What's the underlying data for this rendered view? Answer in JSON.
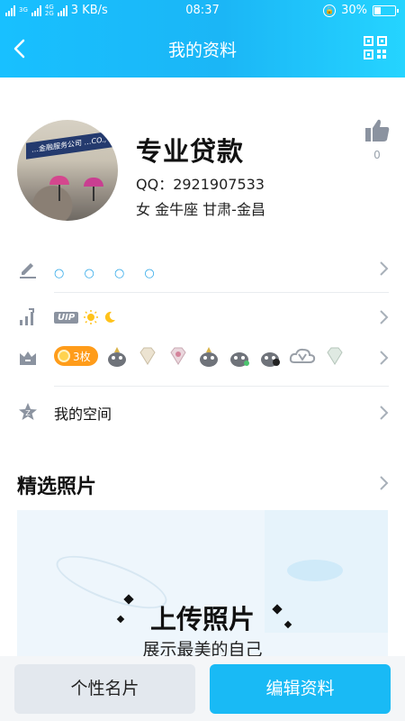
{
  "status_bar": {
    "network_labels": [
      "3G",
      "4G",
      "2G"
    ],
    "speed": "3 KB/s",
    "time": "08:37",
    "battery": "30%",
    "battery_level": 0.3
  },
  "header": {
    "title": "我的资料",
    "back_icon": "chevron-left-icon",
    "qr_icon": "qr-code-icon"
  },
  "profile": {
    "avatar_sign_text": "…金融服务公司 …CO., LTD.",
    "name": "专业贷款",
    "qq": "QQ：2921907533",
    "info": "女  金牛座  甘肃-金昌",
    "likes": "0"
  },
  "rows": {
    "signature_dots": "○ ○ ○ ○",
    "vip_badge": "UIP",
    "level_icons": [
      "sun-icon",
      "moon-icon"
    ],
    "badge_count": "3枚",
    "badges": [
      "mole-icon",
      "diamond-icon",
      "diamond-icon",
      "mole-icon",
      "mole-icon",
      "mole-icon",
      "cloud-v-icon",
      "diamond-icon"
    ],
    "space_label": "我的空间"
  },
  "photos": {
    "title": "精选照片",
    "upload_title": "上传照片",
    "upload_subtitle": "展示最美的自己"
  },
  "bottom": {
    "card_button": "个性名片",
    "edit_button": "编辑资料"
  },
  "colors": {
    "header_blue": "#19baf5",
    "accent_blue": "#2aa6e8",
    "badge_orange": "#ff9c1a",
    "icon_gray": "#8b93a0"
  }
}
